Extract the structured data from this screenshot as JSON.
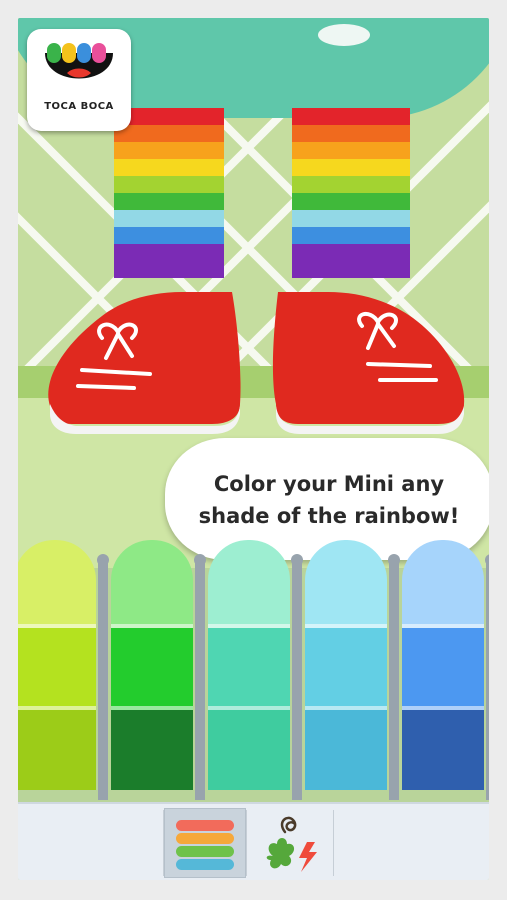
{
  "app": {
    "logo_text": "TOCA BOCA"
  },
  "bubble": {
    "line1": "Color your Mini any",
    "line2": "shade of the rainbow!"
  },
  "colors": {
    "sock_stripes": [
      "#e3242b",
      "#f06a1e",
      "#f7a21c",
      "#f6d81e",
      "#a3d331",
      "#40b93a",
      "#92d8e6",
      "#3d8fe0",
      "#7b2bb5"
    ],
    "shoe": "#e0291f",
    "shoe_sole": "#f4f4f4",
    "palette_columns": [
      [
        "#d8ef66",
        "#b4e21f",
        "#9ccc18"
      ],
      [
        "#8ee986",
        "#23cc2d",
        "#1b7d2b"
      ],
      [
        "#9deed1",
        "#4fd6b2",
        "#3fcc9f"
      ],
      [
        "#9fe6f3",
        "#63cfe4",
        "#4bb8d8"
      ],
      [
        "#a6d4fb",
        "#4c98f1",
        "#2f5fae"
      ],
      [
        "#b7a8f6",
        "#7c5ee5",
        "#6c26d8"
      ]
    ]
  },
  "toolbar": {
    "tools": [
      {
        "name": "blank-tool"
      },
      {
        "name": "color-stripes-tool",
        "selected": true
      },
      {
        "name": "pattern-stickers-tool"
      },
      {
        "name": "empty-tool"
      }
    ]
  }
}
